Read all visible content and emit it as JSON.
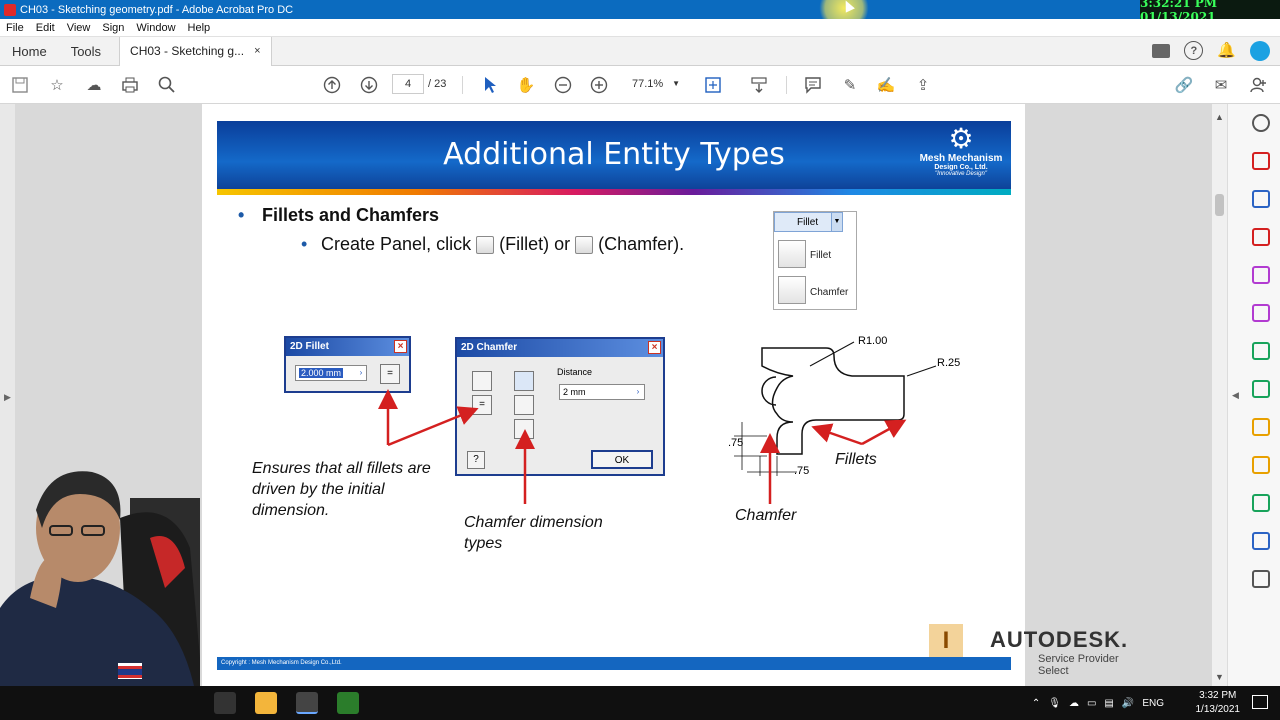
{
  "window": {
    "title": "CH03 - Sketching geometry.pdf - Adobe Acrobat Pro DC",
    "clock_overlay": "3:32:21 PM 01/13/2021"
  },
  "menu": [
    "File",
    "Edit",
    "View",
    "Sign",
    "Window",
    "Help"
  ],
  "tabs": {
    "home": "Home",
    "tools": "Tools",
    "document": "CH03 - Sketching g...",
    "close": "×"
  },
  "toolbar": {
    "page_current": "4",
    "page_total": "/ 23",
    "zoom": "77.1%"
  },
  "slide": {
    "title": "Additional Entity Types",
    "logo": {
      "line1": "Mesh Mechanism",
      "line2": "Design Co., Ltd.",
      "line3": "\"Innovative Design\""
    },
    "bullet1": "Fillets and Chamfers",
    "bullet2": {
      "before": "Create Panel, click",
      "mid": "(Fillet) or",
      "after": "(Chamfer)."
    },
    "fillet_dropdown": {
      "header": "Fillet",
      "options": [
        "Fillet",
        "Chamfer"
      ]
    },
    "fillet_dialog": {
      "title": "2D Fillet",
      "value": "2.000 mm",
      "equal_btn": "="
    },
    "chamfer_dialog": {
      "title": "2D Chamfer",
      "distance_label": "Distance",
      "distance_value": "2 mm",
      "ok": "OK",
      "help": "?",
      "equal_btn": "="
    },
    "annotations": {
      "fillet_note": "Ensures that all fillets are driven by the initial dimension.",
      "chamfer_types": "Chamfer dimension types",
      "fillets": "Fillets",
      "chamfer": "Chamfer"
    },
    "sketch_dims": {
      "r1": "R1.00",
      "r2": "R.25",
      "d1": ".75",
      "d2": ".75"
    },
    "footer": "Copyright : Mesh Mechanism Design Co.,Ltd.",
    "autodesk": {
      "name": "AUTODESK.",
      "sub": "Service Provider Select"
    }
  },
  "taskbar": {
    "lang": "ENG",
    "time": "3:32 PM",
    "date": "1/13/2021"
  }
}
